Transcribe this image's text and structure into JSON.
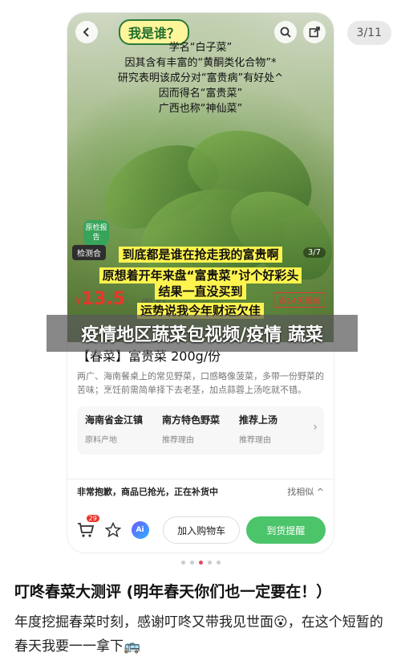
{
  "page_counter": "3/11",
  "hero": {
    "bubble": "我是谁？",
    "intro_lines": [
      "学名“白子菜”",
      "因其含有丰富的“黄酮类化合物”*",
      "研究表明该成分对“富贵病”有好处^",
      "因而得名“富贵菜”",
      "广西也称“神仙菜”"
    ],
    "badge": "原检报告",
    "test_tag": "检测合",
    "image_counter": "3/7",
    "captions": [
      "到底都是谁在抢走我的富贵啊",
      "原想着开年来盘“富贵菜”讨个好彩头",
      "结果一直没买到",
      "运势说我今年财运欠佳"
    ]
  },
  "price": {
    "currency": "¥",
    "amount": "13.5",
    "unit": "/份 ¥1",
    "discount": "近14天低价"
  },
  "product": {
    "title": "【春菜】富贵菜 200g/份",
    "description": "两广、海南餐桌上的常见野菜，口感略像菠菜，多带一份野菜的苦味；烹饪前需简单择下去老茎，加点蒜蓉上汤吃就不错。",
    "attrs": [
      {
        "value": "海南省金江镇",
        "key": "原料产地"
      },
      {
        "value": "南方特色野菜",
        "key": "推荐理由"
      },
      {
        "value": "推荐上汤",
        "key": "推荐理由"
      }
    ]
  },
  "stock": {
    "notice": "非常抱歉，商品已抢光，正在补货中",
    "similar": "找相似 ^"
  },
  "actions": {
    "cart_count": "29",
    "ai_label": "Ai",
    "add_to_cart": "加入购物车",
    "notify": "到货提醒"
  },
  "watermark": "疫情地区蔬菜包视频/疫情 蔬菜",
  "post": {
    "title": "叮咚春菜大测评 (明年春天你们也一定要在！）",
    "body": "年度挖掘春菜时刻，感谢叮咚又带我见世面😮，在这个短暂的春天我要一一拿下🚌"
  },
  "colors": {
    "price_red": "#e9362b",
    "brand_green": "#4cc46a"
  }
}
